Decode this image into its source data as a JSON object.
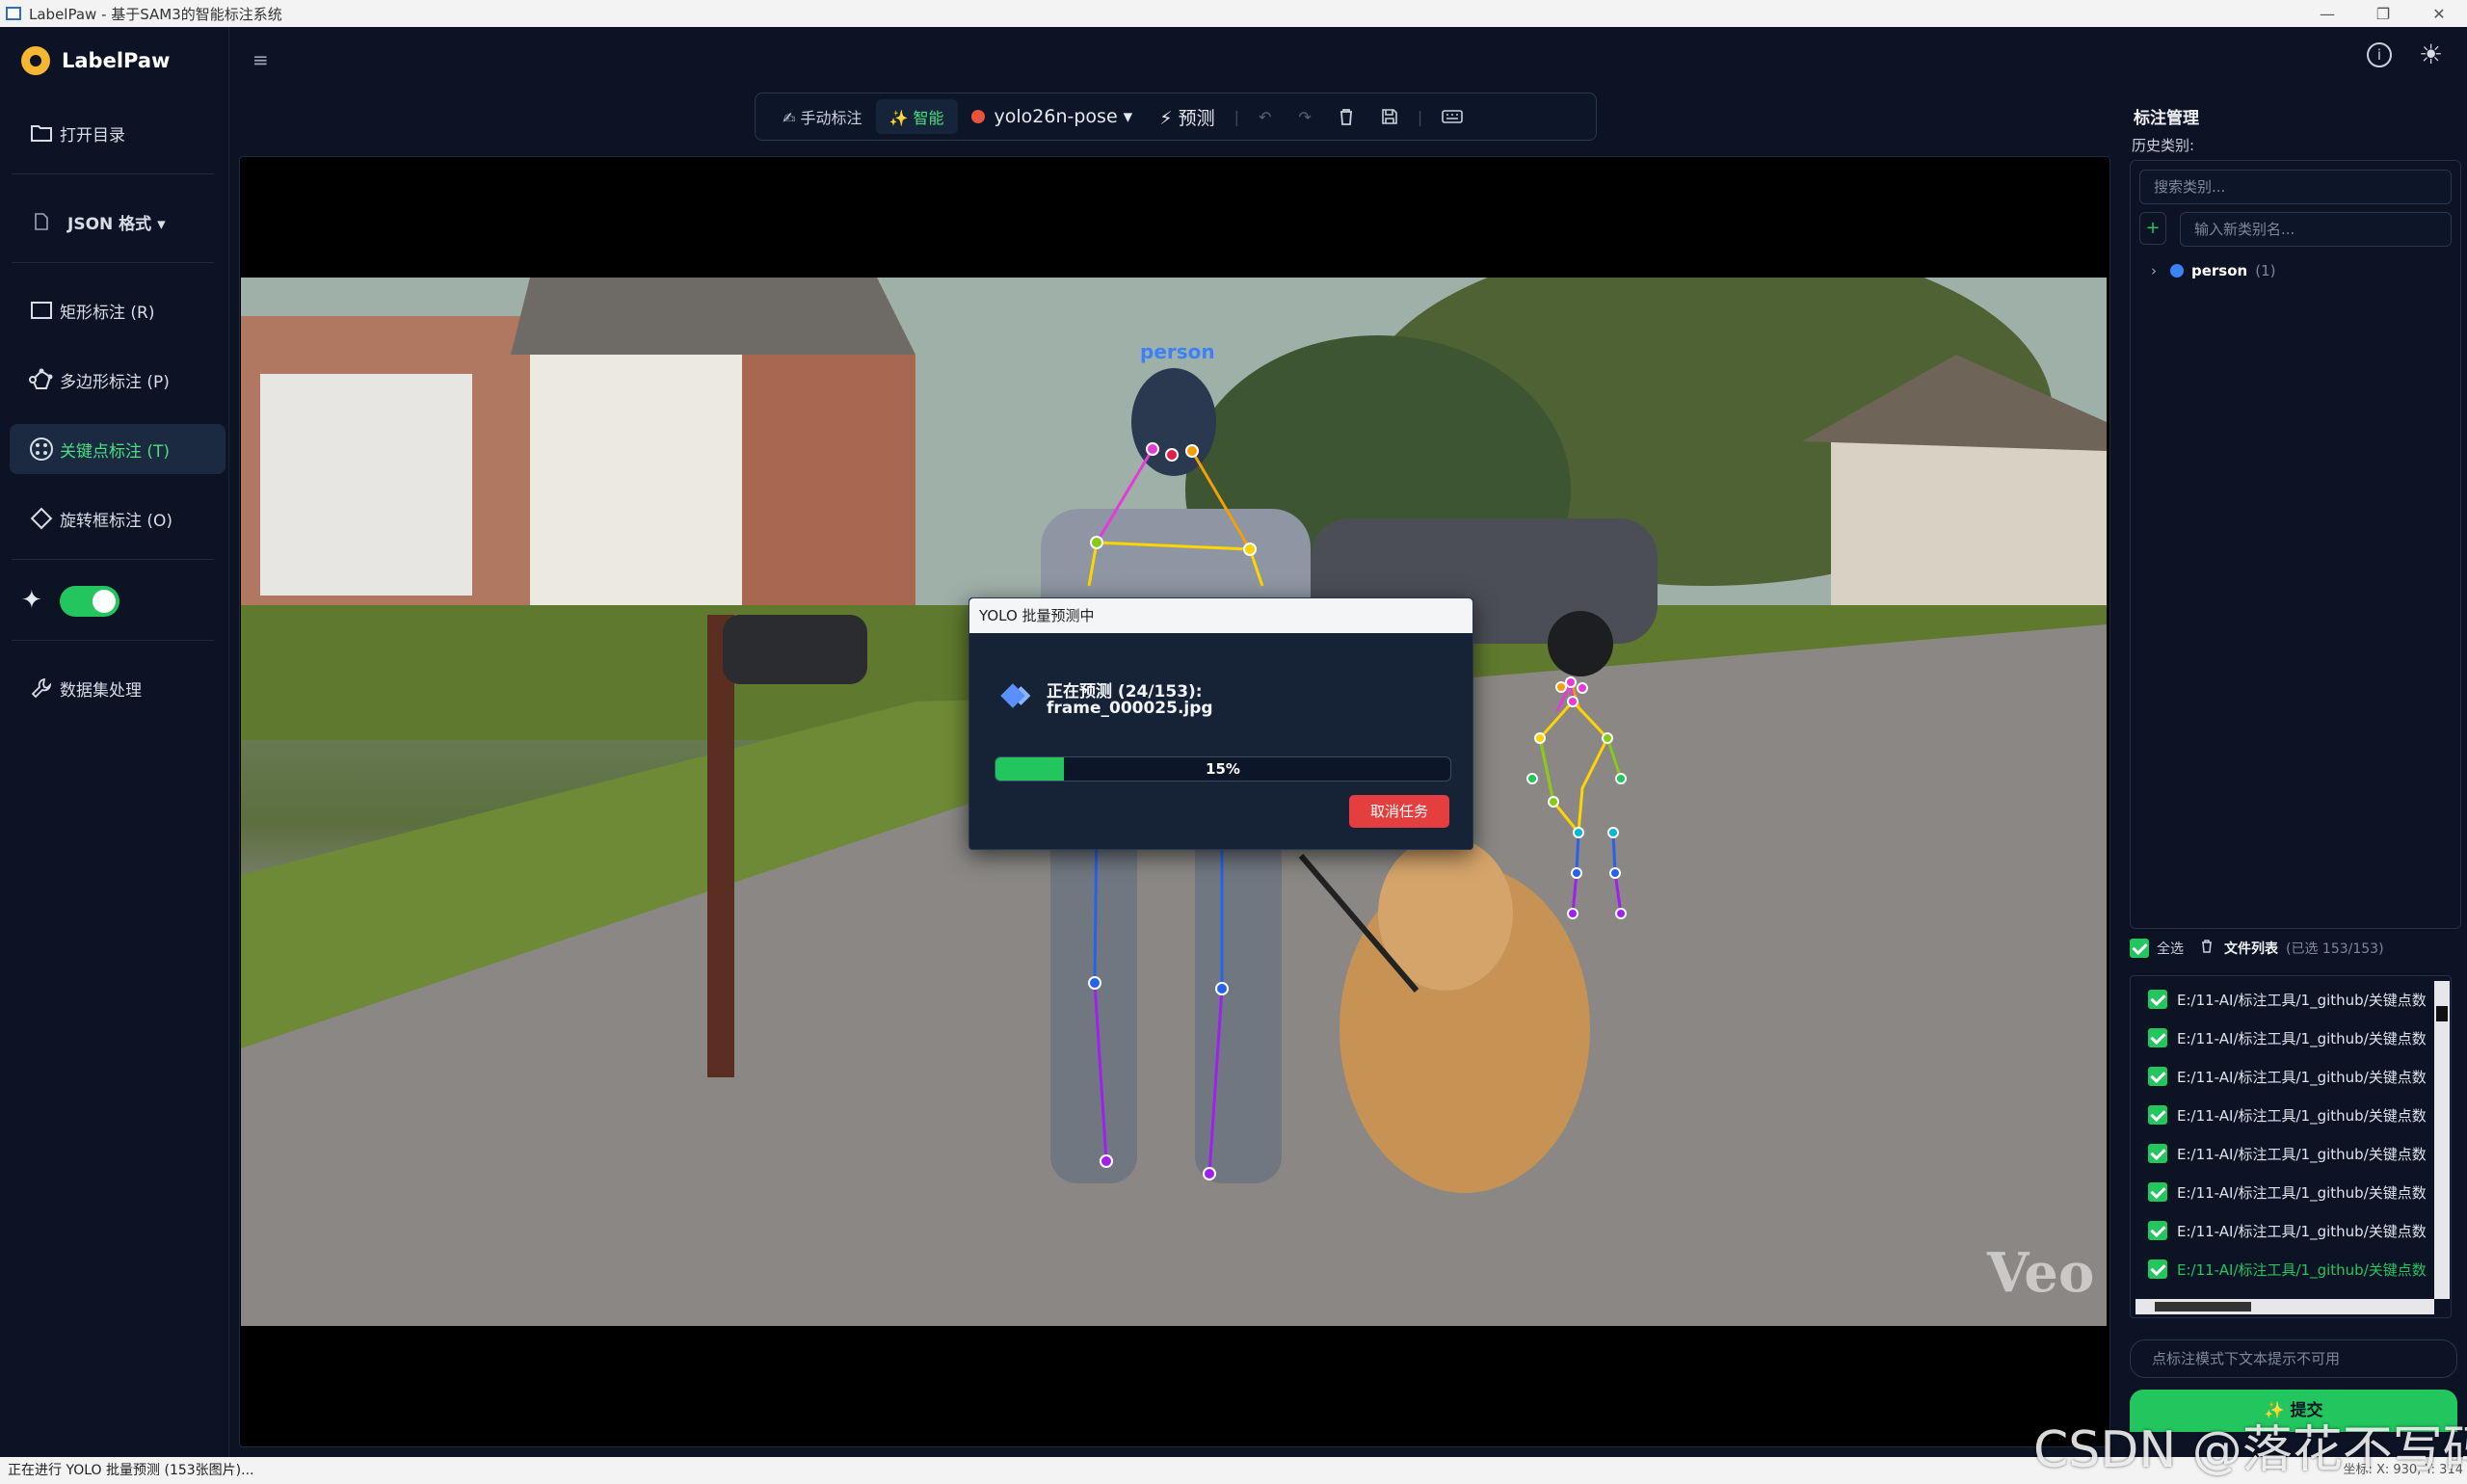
{
  "window": {
    "title": "LabelPaw - 基于SAM3的智能标注系统",
    "minimize": "—",
    "maximize": "❐",
    "close": "✕"
  },
  "sidebar": {
    "logo": "LabelPaw",
    "open_dir": "打开目录",
    "format": "JSON 格式 ▾",
    "tools": [
      {
        "label": "矩形标注 (R)",
        "icon": "rectangle-icon"
      },
      {
        "label": "多边形标注 (P)",
        "icon": "polygon-icon"
      },
      {
        "label": "关键点标注 (T)",
        "icon": "keypoint-icon",
        "active": true
      },
      {
        "label": "旋转框标注 (O)",
        "icon": "rotated-box-icon"
      }
    ],
    "ai_toggle": true,
    "dataset": "数据集处理"
  },
  "toolbar": {
    "manual": "✍ 手动标注",
    "smart": "✨ 智能",
    "model": "yolo26n-pose ▾",
    "predict": "⚡ 预测"
  },
  "canvas": {
    "class_label": "person",
    "watermark": "Veo"
  },
  "modal": {
    "title": "YOLO 批量预测中",
    "status": "正在预测 (24/153):",
    "file": "frame_000025.jpg",
    "progress": 15,
    "progress_text": "15%",
    "cancel": "取消任务"
  },
  "right_panel": {
    "title": "标注管理",
    "history_label": "历史类别:",
    "search_placeholder": "搜索类别...",
    "new_class_placeholder": "输入新类别名...",
    "classes": [
      {
        "name": "person",
        "count": "(1)",
        "color": "#3b82f6"
      }
    ],
    "select_all": "全选",
    "file_list_title": "文件列表",
    "file_list_count": "(已选 153/153)",
    "files": [
      "E:/11-AI/标注工具/1_github/关键点数",
      "E:/11-AI/标注工具/1_github/关键点数",
      "E:/11-AI/标注工具/1_github/关键点数",
      "E:/11-AI/标注工具/1_github/关键点数",
      "E:/11-AI/标注工具/1_github/关键点数",
      "E:/11-AI/标注工具/1_github/关键点数",
      "E:/11-AI/标注工具/1_github/关键点数",
      "E:/11-AI/标注工具/1_github/关键点数"
    ],
    "hint": "点标注模式下文本提示不可用",
    "submit": "✨ 提交"
  },
  "statusbar": {
    "text": "正在进行 YOLO 批量预测 (153张图片)...",
    "coords": "坐标: X: 930, Y: 314"
  },
  "watermark": "CSDN @落花不写码",
  "colors": {
    "accent": "#22c55e",
    "bg": "#0b1324",
    "danger": "#e53e3e",
    "class_person": "#3b82f6"
  }
}
